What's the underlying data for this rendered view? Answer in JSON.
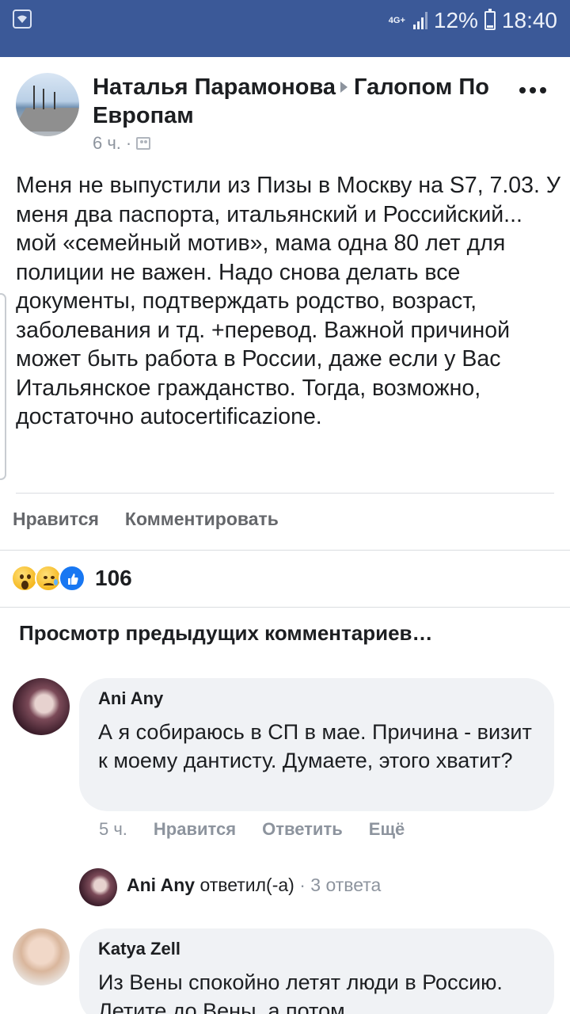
{
  "status_bar": {
    "network": "4G+",
    "battery": "12%",
    "time": "18:40",
    "icons": [
      "wifi-icon",
      "signal-icon",
      "battery-icon"
    ]
  },
  "post": {
    "author": "Наталья Парамонова",
    "group": "Галопом По Европам",
    "time": "6 ч.",
    "privacy_icon": "group-icon",
    "text": "Меня не выпустили из Пизы в Москву на S7, 7.03. У меня два паспорта, итальянский и Российский... мой «семейный мотив», мама одна 80 лет для полиции не важен. Надо снова делать все документы, подтверждать родство, возраст, заболевания и тд. +перевод. Важной причиной может быть работа в России, даже если у Вас Итальянское гражданство. Тогда, возможно, достаточно autocertificazione.",
    "like_label": "Нравится",
    "comment_label": "Комментировать",
    "reaction_count": "106",
    "reactions": [
      "wow",
      "sad",
      "like"
    ]
  },
  "comments_section": {
    "previous_label": "Просмотр предыдущих комментариев…",
    "comments": [
      {
        "author": "Ani Any",
        "text": "А я собираюсь в СП в мае. Причина - визит к моему дантисту. Думаете, этого хватит?",
        "time": "5 ч.",
        "like_label": "Нравится",
        "reply_label": "Ответить",
        "more_label": "Ещё",
        "replies": {
          "author": "Ani Any",
          "action": "ответил(-а)",
          "separator": "·",
          "count": "3 ответа"
        }
      },
      {
        "author": "Katya Zell",
        "text": "Из Вены спокойно летят люди в Россию. Летите до Вены, а потом"
      }
    ]
  }
}
